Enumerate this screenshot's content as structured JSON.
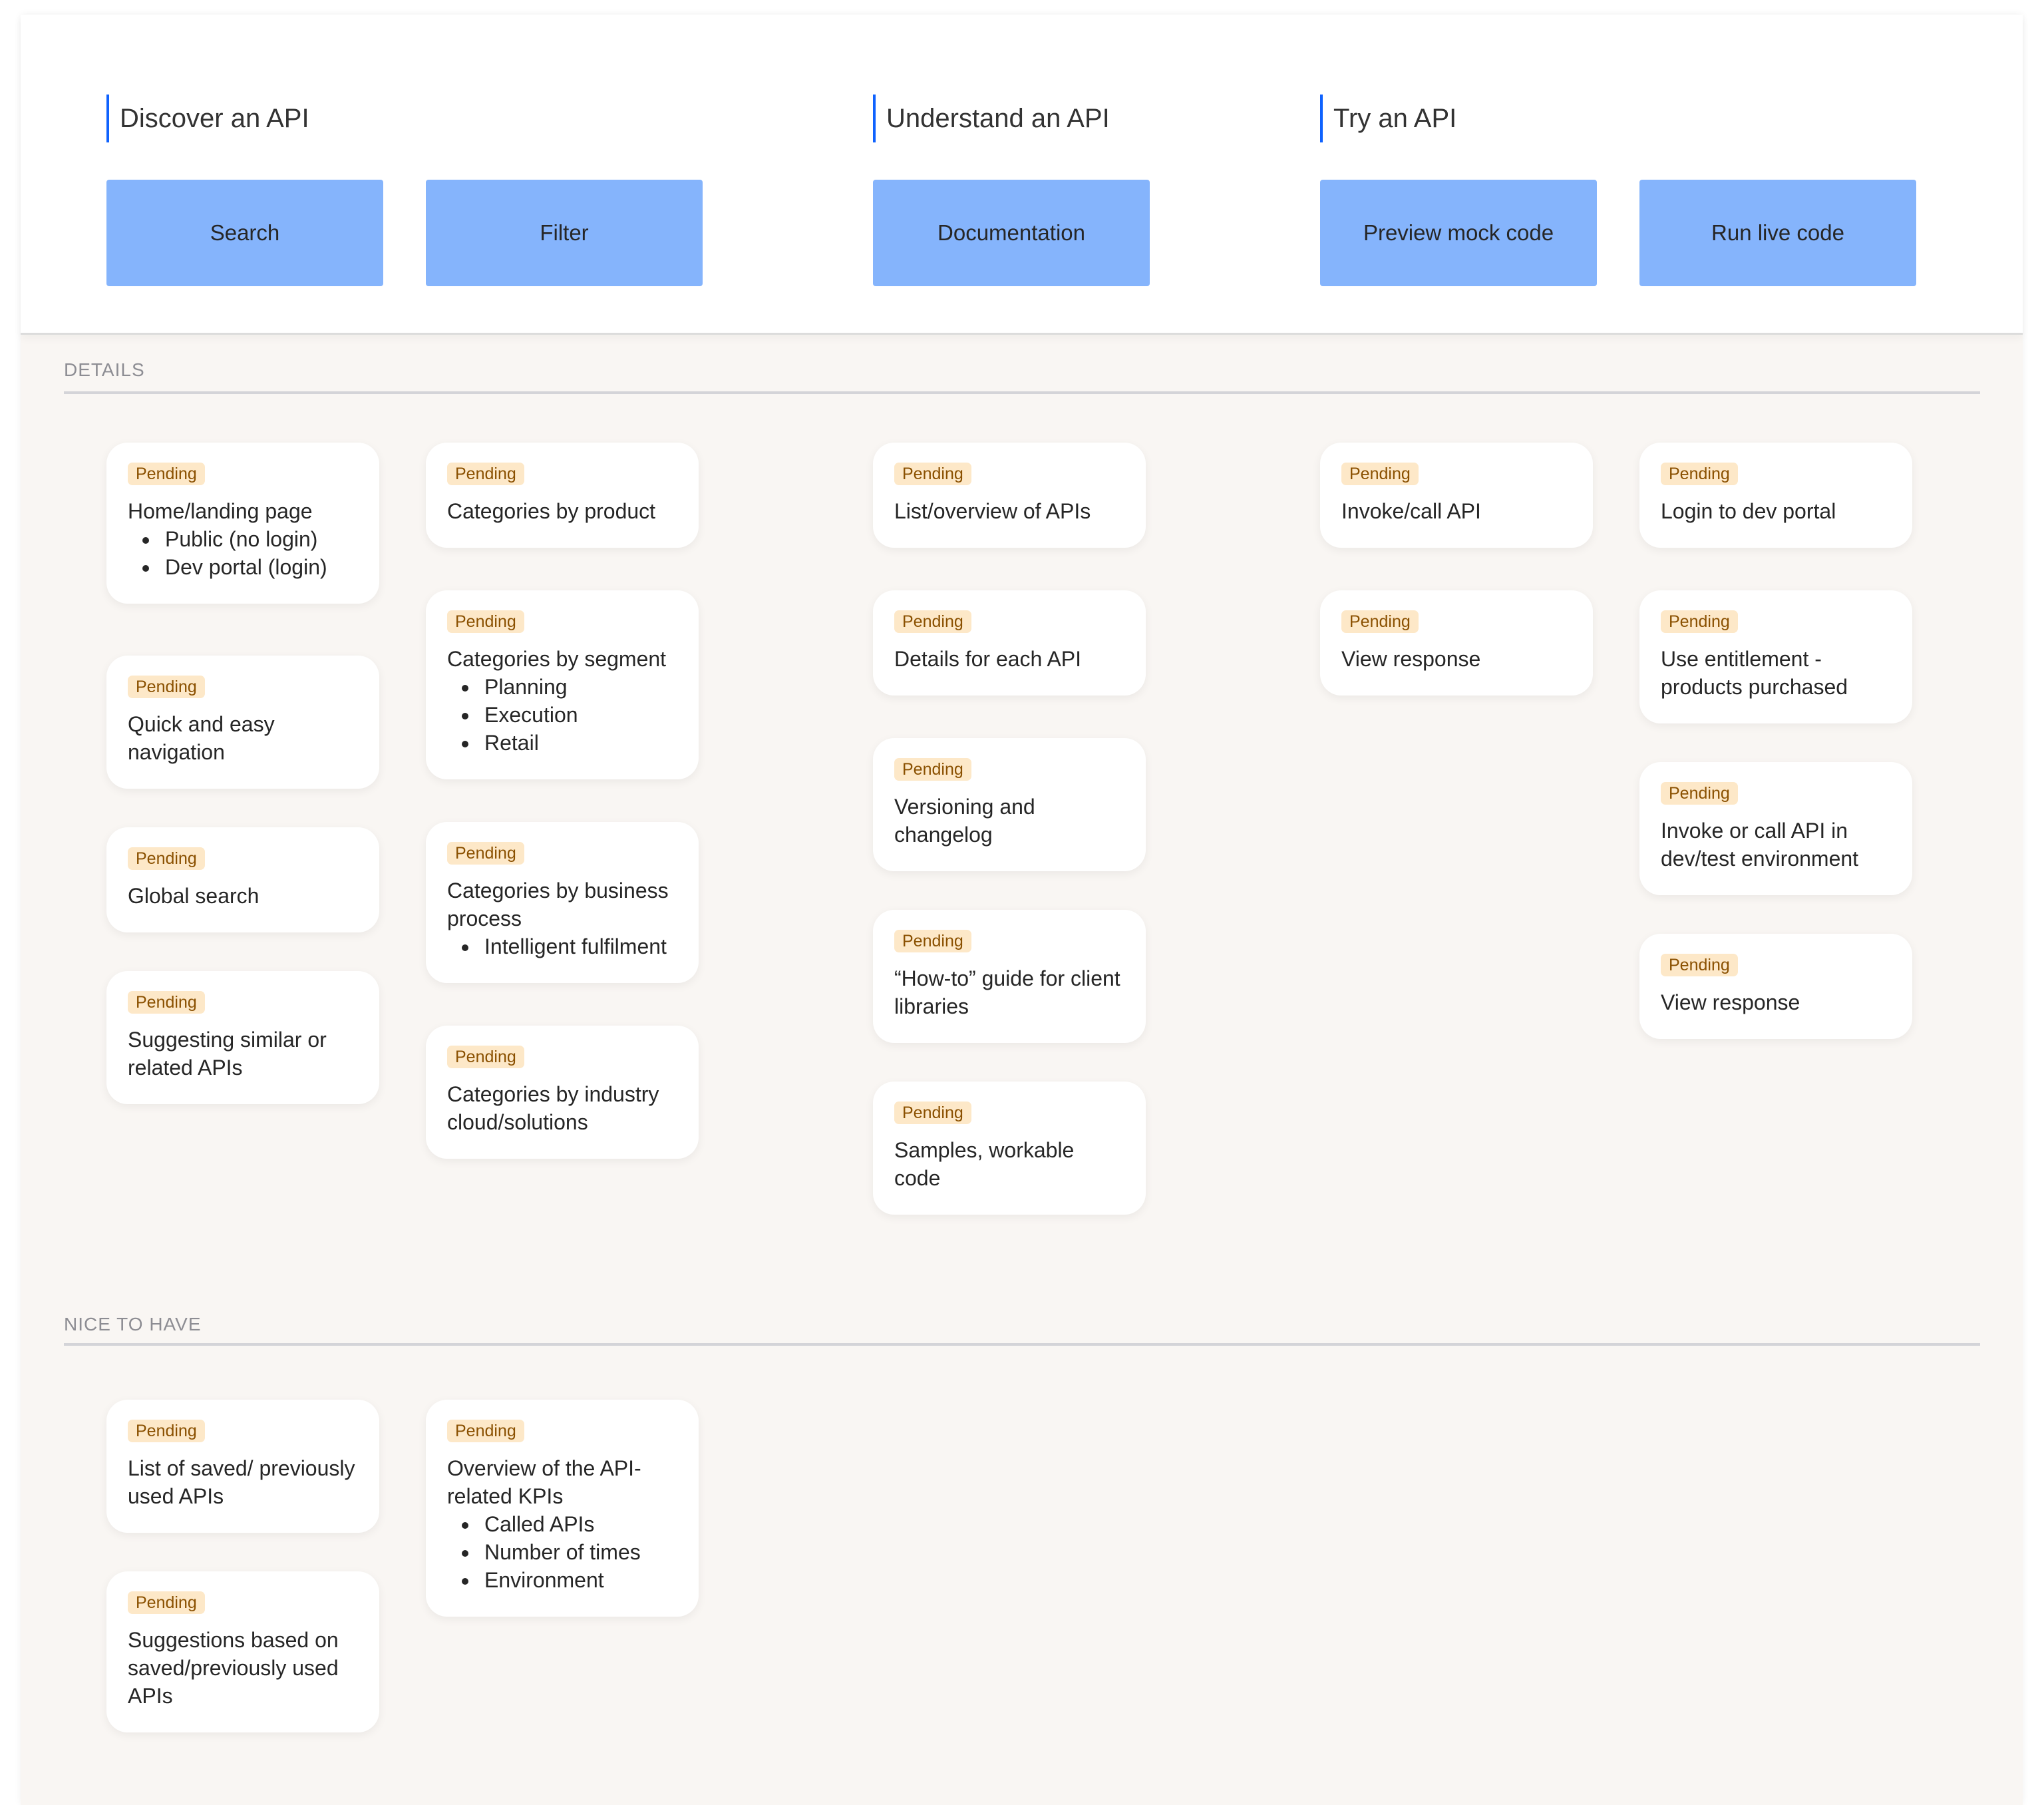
{
  "stages": [
    {
      "title": "Discover an API",
      "buttons": [
        "Search",
        "Filter"
      ]
    },
    {
      "title": "Understand an API",
      "buttons": [
        "Documentation"
      ]
    },
    {
      "title": "Try an API",
      "buttons": [
        "Preview mock code",
        "Run live code"
      ]
    }
  ],
  "colors": {
    "accent": "#0f62fe",
    "button_fill": "#85b4fc",
    "badge_fill": "#fde8c8",
    "badge_text": "#8a5000",
    "board_bg": "#f9f6f3"
  },
  "details": {
    "label": "DETAILS",
    "columns": [
      [
        {
          "status": "Pending",
          "title": "Home/landing page",
          "bullets": [
            "Public (no login)",
            "Dev portal (login)"
          ]
        },
        {
          "status": "Pending",
          "title": "Quick and easy navigation",
          "bullets": []
        },
        {
          "status": "Pending",
          "title": "Global search",
          "bullets": []
        },
        {
          "status": "Pending",
          "title": "Suggesting similar or related APIs",
          "bullets": []
        }
      ],
      [
        {
          "status": "Pending",
          "title": "Categories by product",
          "bullets": []
        },
        {
          "status": "Pending",
          "title": "Categories by segment",
          "bullets": [
            "Planning",
            "Execution",
            "Retail"
          ]
        },
        {
          "status": "Pending",
          "title": "Categories by business process",
          "bullets": [
            "Intelligent fulfilment"
          ]
        },
        {
          "status": "Pending",
          "title": "Categories by industry cloud/solutions",
          "bullets": []
        }
      ],
      [
        {
          "status": "Pending",
          "title": "List/overview of APIs",
          "bullets": []
        },
        {
          "status": "Pending",
          "title": "Details for each API",
          "bullets": []
        },
        {
          "status": "Pending",
          "title": "Versioning and changelog",
          "bullets": []
        },
        {
          "status": "Pending",
          "title": "“How-to” guide for client libraries",
          "bullets": []
        },
        {
          "status": "Pending",
          "title": "Samples, workable code",
          "bullets": []
        }
      ],
      [
        {
          "status": "Pending",
          "title": "Invoke/call API",
          "bullets": []
        },
        {
          "status": "Pending",
          "title": "View response",
          "bullets": []
        }
      ],
      [
        {
          "status": "Pending",
          "title": "Login to dev portal",
          "bullets": []
        },
        {
          "status": "Pending",
          "title": "Use entitlement - products purchased",
          "bullets": []
        },
        {
          "status": "Pending",
          "title": "Invoke or call API in dev/test environment",
          "bullets": []
        },
        {
          "status": "Pending",
          "title": "View response",
          "bullets": []
        }
      ]
    ]
  },
  "nice_to_have": {
    "label": "NICE TO HAVE",
    "columns": [
      [
        {
          "status": "Pending",
          "title": "List of saved/ previously used APIs",
          "bullets": []
        },
        {
          "status": "Pending",
          "title": "Suggestions based on saved/previously used APIs",
          "bullets": []
        }
      ],
      [
        {
          "status": "Pending",
          "title": "Overview of the API-related KPIs",
          "bullets": [
            "Called APIs",
            "Number of times",
            "Environment"
          ]
        }
      ]
    ]
  }
}
